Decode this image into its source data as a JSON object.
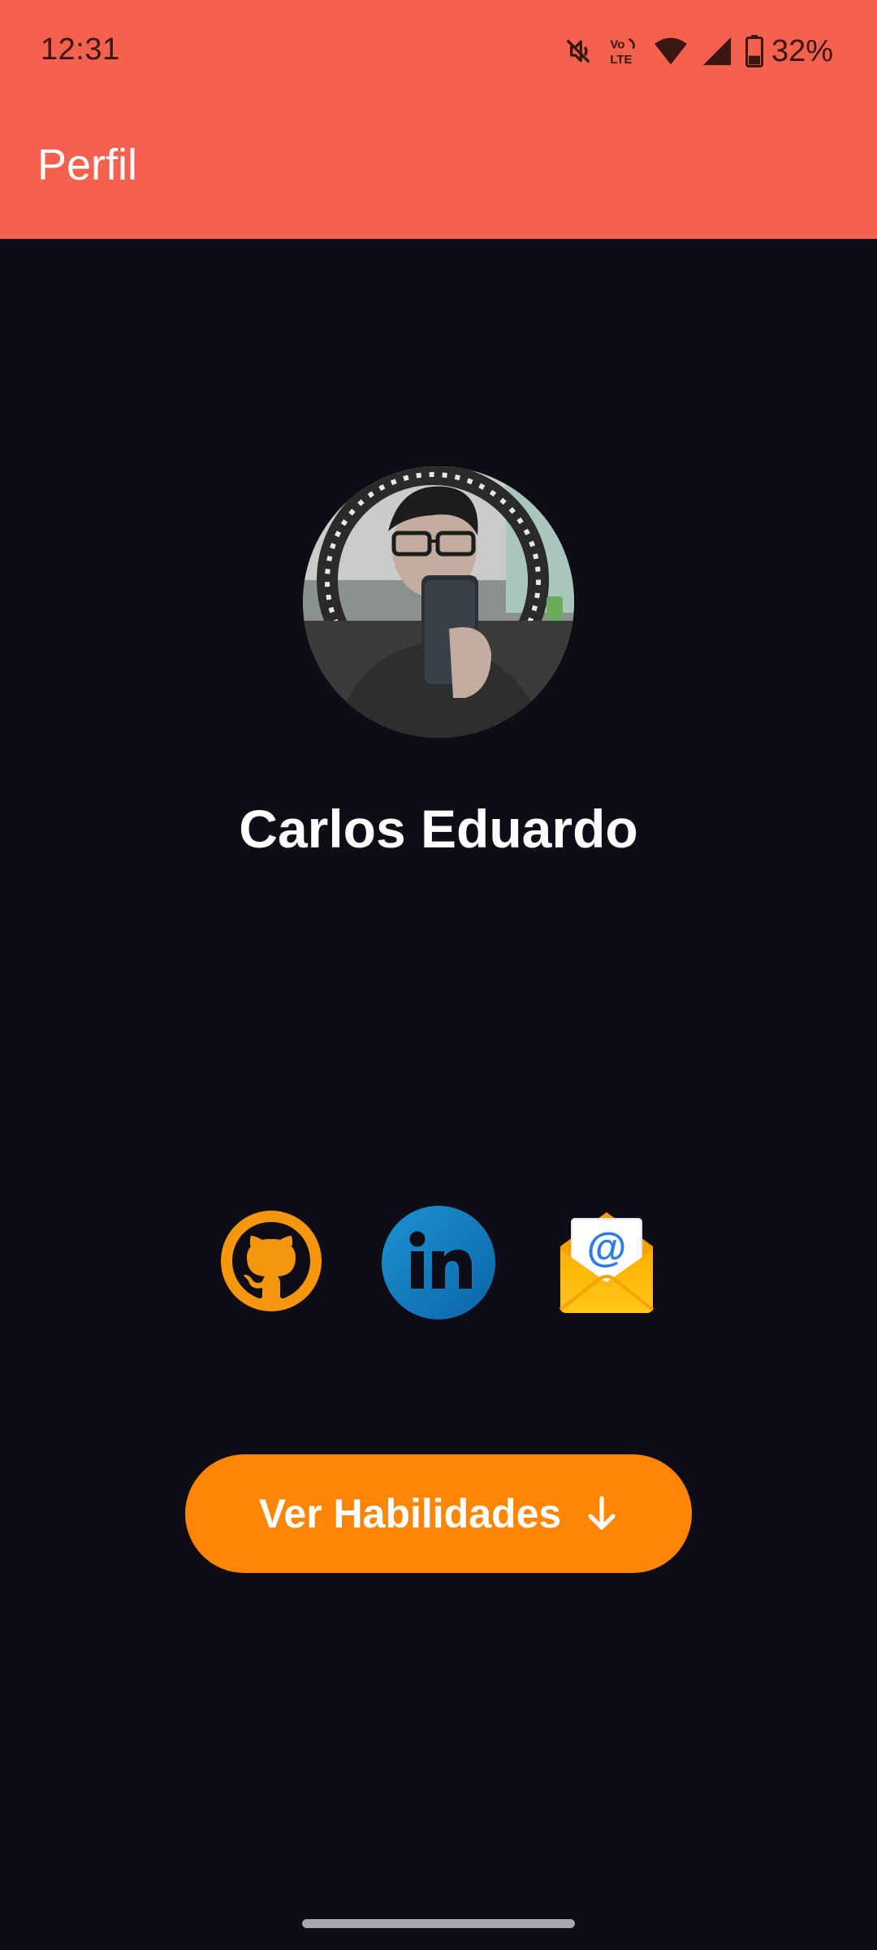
{
  "status_bar": {
    "time": "12:31",
    "battery": "32%",
    "icons": [
      "mute-icon",
      "volte-icon",
      "wifi-icon",
      "signal-icon",
      "battery-icon"
    ]
  },
  "app_bar": {
    "title": "Perfil",
    "color": "#f4614f"
  },
  "profile": {
    "avatar": "profile-photo",
    "name": "Carlos Eduardo"
  },
  "social_links": [
    {
      "icon": "github-icon",
      "color": "#f6960c"
    },
    {
      "icon": "linkedin-icon",
      "color": "#1b7fc2"
    },
    {
      "icon": "email-icon",
      "color": "#ffb400"
    }
  ],
  "cta": {
    "label": "Ver Habilidades",
    "icon": "arrow-down-icon",
    "color": "#ff8605"
  },
  "colors": {
    "background": "#0e0d16",
    "text": "#ffffff"
  }
}
